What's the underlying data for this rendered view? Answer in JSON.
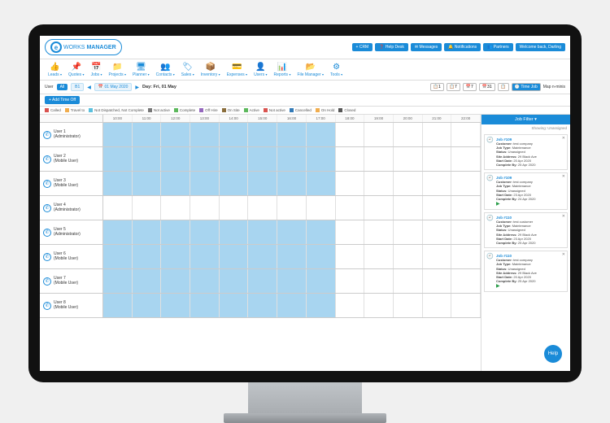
{
  "logo": {
    "letter": "e",
    "part1": "WORKS",
    "part2": "MANAGER"
  },
  "topButtons": [
    {
      "label": "+ CRM"
    },
    {
      "label": "❓ Help Desk"
    },
    {
      "label": "✉ Messages"
    },
    {
      "label": "🔔 Notifications"
    },
    {
      "label": "👥 Partners"
    },
    {
      "label": "Welcome back, Darling"
    }
  ],
  "nav": [
    {
      "icon": "👍",
      "label": "Leads"
    },
    {
      "icon": "📌",
      "label": "Quotes"
    },
    {
      "icon": "📅",
      "label": "Jobs"
    },
    {
      "icon": "📁",
      "label": "Projects"
    },
    {
      "icon": "🖥",
      "label": "Planner"
    },
    {
      "icon": "👥",
      "label": "Contacts"
    },
    {
      "icon": "🏷",
      "label": "Sales"
    },
    {
      "icon": "📦",
      "label": "Inventory"
    },
    {
      "icon": "💳",
      "label": "Expenses"
    },
    {
      "icon": "👤",
      "label": "Users"
    },
    {
      "icon": "📊",
      "label": "Reports"
    },
    {
      "icon": "📂",
      "label": "File Manager"
    },
    {
      "icon": "⚙",
      "label": "Tools"
    }
  ],
  "toolbar": {
    "userLabel": "User",
    "userAll": "All",
    "userB1": "B1",
    "dateLeft": "01 May 2020",
    "dayLabel": "Day: Fri, 01 May",
    "viewBtns": [
      "📋1",
      "📋7",
      "📅7",
      "📅31",
      "📋"
    ],
    "timeJob": "🕐 Time Job",
    "mapMinis": "Map n-minis"
  },
  "addTimeOff": "+ Add Time Off",
  "legend": [
    {
      "color": "#d9534f",
      "label": "Called"
    },
    {
      "color": "#f0ad4e",
      "label": "Travel to"
    },
    {
      "color": "#5bc0de",
      "label": "Not Dispatched, Not Complete"
    },
    {
      "color": "#777",
      "label": "Not active"
    },
    {
      "color": "#5cb85c",
      "label": "Complete"
    },
    {
      "color": "#9467bd",
      "label": "Off Hire"
    },
    {
      "color": "#8a6d3b",
      "label": "On Site"
    },
    {
      "color": "#5cb85c",
      "label": "Active"
    },
    {
      "color": "#d9534f",
      "label": "Not active"
    },
    {
      "color": "#337ab7",
      "label": "Cancelled"
    },
    {
      "color": "#f0ad4e",
      "label": "On Hold"
    },
    {
      "color": "#555",
      "label": "Closed"
    }
  ],
  "hours": [
    "10:00",
    "11:00",
    "12:00",
    "13:00",
    "14:00",
    "15:00",
    "16:00",
    "17:00",
    "18:00",
    "19:00",
    "20:00",
    "21:00",
    "22:00"
  ],
  "users": [
    {
      "name": "User 1",
      "role": "(Administrator)",
      "hl": [
        0,
        1,
        2,
        3,
        4,
        5,
        6,
        7
      ]
    },
    {
      "name": "User 2",
      "role": "(Mobile User)",
      "hl": [
        0,
        1,
        2,
        3,
        4,
        5,
        6,
        7
      ]
    },
    {
      "name": "User 3",
      "role": "(Mobile User)",
      "hl": [
        0,
        1,
        2,
        3,
        4,
        5,
        6,
        7
      ]
    },
    {
      "name": "User 4",
      "role": "(Administrator)",
      "hl": []
    },
    {
      "name": "User 5",
      "role": "(Administrator)",
      "hl": [
        0,
        1,
        2,
        3,
        4,
        5,
        6,
        7
      ]
    },
    {
      "name": "User 6",
      "role": "(Mobile User)",
      "hl": [
        0,
        1,
        2,
        3,
        4,
        5,
        6,
        7
      ]
    },
    {
      "name": "User 7",
      "role": "(Mobile User)",
      "hl": [
        0,
        1,
        2,
        3,
        4,
        5,
        6,
        7
      ]
    },
    {
      "name": "User 8",
      "role": "(Mobile User)",
      "hl": [
        0,
        1,
        2,
        3,
        4,
        5,
        6,
        7
      ]
    }
  ],
  "sidepanel": {
    "filterTitle": "Job Filter ▾",
    "showing": "Showing: Unassigned",
    "jobs": [
      {
        "num": "Job #109",
        "customer": "test company",
        "type": "Maintenance",
        "status": "Unassigned",
        "address": "29 Black Ave",
        "start": "20 Apr 2020",
        "complete": "25 Apr 2020",
        "play": false
      },
      {
        "num": "Job #109",
        "customer": "test company",
        "type": "Maintenance",
        "status": "Unassigned",
        "start": "23 Apr 2020",
        "complete": "24 Apr 2020",
        "play": true
      },
      {
        "num": "Job #110",
        "customer": "test customer",
        "type": "Maintenance",
        "status": "Unassigned",
        "address": "29 Black Ave",
        "start": "23 Apr 2020",
        "complete": "25 Apr 2020",
        "play": false
      },
      {
        "num": "Job #110",
        "customer": "test company",
        "type": "Maintenance",
        "status": "Unassigned",
        "address": "29 Black Ave",
        "start": "20 Apr 2020",
        "complete": "25 Apr 2020",
        "play": true
      }
    ]
  },
  "help": "Help"
}
